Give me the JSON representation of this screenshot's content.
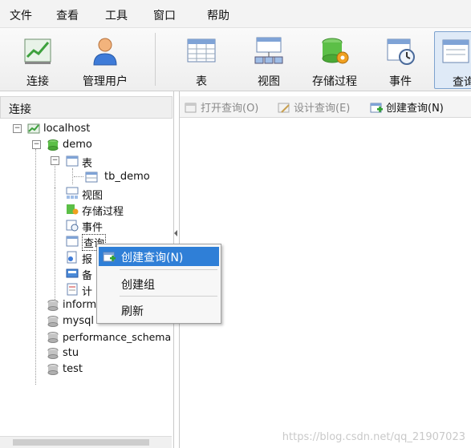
{
  "menubar": {
    "items": [
      "文件",
      "查看",
      "工具",
      "窗口",
      "帮助"
    ]
  },
  "toolbar": {
    "buttons": [
      {
        "label": "连接",
        "icon": "connection-icon"
      },
      {
        "label": "管理用户",
        "icon": "user-icon"
      },
      {
        "label": "表",
        "icon": "table-icon"
      },
      {
        "label": "视图",
        "icon": "view-icon"
      },
      {
        "label": "存储过程",
        "icon": "procedure-icon"
      },
      {
        "label": "事件",
        "icon": "event-icon"
      },
      {
        "label": "查询",
        "icon": "query-icon",
        "active": true
      }
    ]
  },
  "left_panel": {
    "title": "连接",
    "tree": {
      "root": "localhost",
      "db": "demo",
      "tables_label": "表",
      "table_item": "tb_demo",
      "views": "视图",
      "procedures": "存储过程",
      "events": "事件",
      "queries": "查询",
      "reports_partial": "报",
      "backup_partial": "备",
      "schedule_partial": "计",
      "other_dbs": [
        "inform",
        "mysql",
        "performance_schema",
        "stu",
        "test"
      ]
    }
  },
  "right_panel": {
    "subtoolbar": [
      {
        "label": "打开查询(O)",
        "enabled": false
      },
      {
        "label": "设计查询(E)",
        "enabled": false
      },
      {
        "label": "创建查询(N)",
        "enabled": true
      }
    ]
  },
  "context_menu": {
    "items": [
      {
        "label": "创建查询(N)",
        "highlighted": true
      },
      {
        "label": "创建组"
      },
      {
        "label": "刷新"
      }
    ]
  },
  "watermark": "https://blog.csdn.net/qq_21907023",
  "colors": {
    "highlight": "#2f7fd7",
    "toolbar_active": "#dfeaf7"
  }
}
